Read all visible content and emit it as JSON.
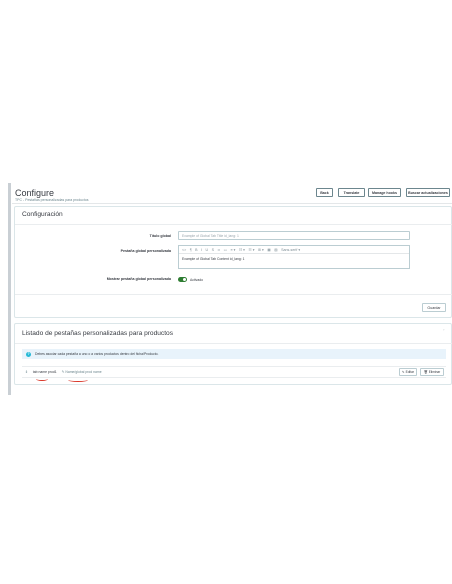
{
  "header": {
    "title": "Configure",
    "subtitle": "TPC - Pestañas personalizadas para productos",
    "buttons": [
      "Back",
      "Translate",
      "Manage hooks",
      "Buscar actualizaciones"
    ]
  },
  "config_panel": {
    "title": "Configuración",
    "fields": {
      "global_title_label": "Título global",
      "global_title_value": "Example of Global Tab Title id_lang: 1",
      "global_tab_label": "Pestaña global personalizada",
      "editor_toolbar": [
        "<>",
        "¶",
        "B",
        "I",
        "U",
        "S",
        "∞",
        "▭",
        "≡ ▾",
        "☷ ▾",
        "☷ ▾",
        "⊞ ▾",
        "▦",
        "▨",
        "Sans-serif ▾"
      ],
      "editor_content": "Example of Global Tab Content id_lang: 1",
      "show_global_label": "Mostrar pestaña global personalizada",
      "show_global_state": "Activado"
    },
    "save_label": "Guardar"
  },
  "list_panel": {
    "title": "Listado de pestañas personalizadas para productos",
    "alert": "Debes asociar cada pestaña a uno o a varios productos dentro del ficha/Producto.",
    "rows": [
      {
        "handle": "⇕",
        "name": "tab name prod1",
        "badge": "✎ Name/global prod name",
        "edit_label": "✎ Editar",
        "delete_label": "🗑 Eliminar"
      }
    ]
  },
  "colors": {
    "accent": "#25b9d7",
    "toggle_on": "#2e7d32",
    "annotation": "#d9372a"
  }
}
